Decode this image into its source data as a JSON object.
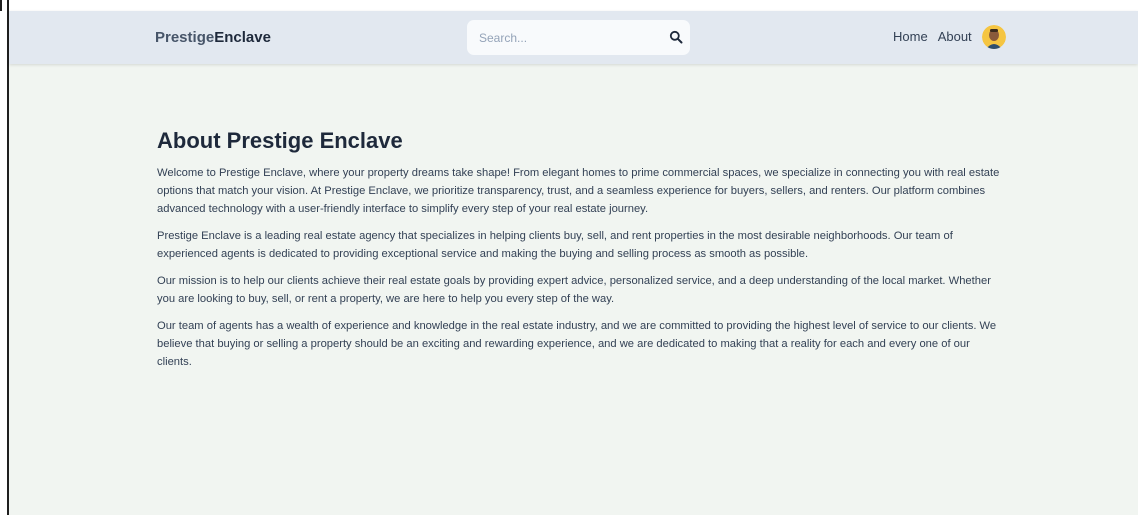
{
  "navbar": {
    "brand_prefix": "Prestige",
    "brand_suffix": "Enclave",
    "search_placeholder": "Search...",
    "links": [
      "Home",
      "About"
    ],
    "avatar_icon": "user-avatar"
  },
  "about": {
    "title": "About Prestige Enclave",
    "paragraphs": [
      "Welcome to Prestige Enclave, where your property dreams take shape! From elegant homes to prime commercial spaces, we specialize in connecting you with real estate options that match your vision. At Prestige Enclave, we prioritize transparency, trust, and a seamless experience for buyers, sellers, and renters. Our platform combines advanced technology with a user-friendly interface to simplify every step of your real estate journey.",
      "Prestige Enclave is a leading real estate agency that specializes in helping clients buy, sell, and rent properties in the most desirable neighborhoods. Our team of experienced agents is dedicated to providing exceptional service and making the buying and selling process as smooth as possible.",
      "Our mission is to help our clients achieve their real estate goals by providing expert advice, personalized service, and a deep understanding of the local market. Whether you are looking to buy, sell, or rent a property, we are here to help you every step of the way.",
      "Our team of agents has a wealth of experience and knowledge in the real estate industry, and we are committed to providing the highest level of service to our clients. We believe that buying or selling a property should be an exciting and rewarding experience, and we are dedicated to making that a reality for each and every one of our clients."
    ]
  },
  "colors": {
    "navbar_bg": "#e2e8f0",
    "page_bg": "#f1f5f1",
    "heading": "#1e293b",
    "text": "#334155"
  }
}
